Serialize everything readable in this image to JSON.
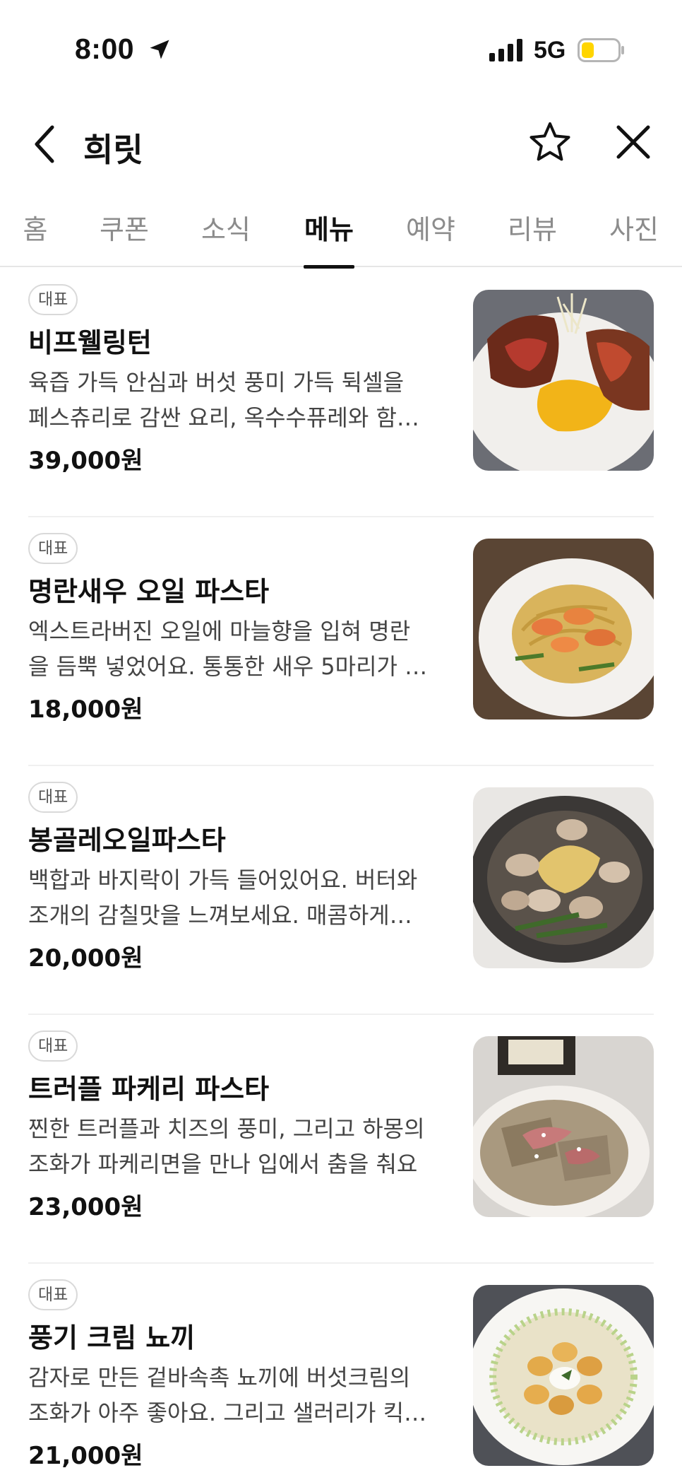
{
  "status_bar": {
    "time": "8:00",
    "network": "5G",
    "icons": [
      "location-arrow-icon",
      "signal-icon",
      "battery-icon"
    ],
    "battery_color": "#ffd500"
  },
  "header": {
    "title": "희릿",
    "icons": [
      "back-icon",
      "star-icon",
      "close-icon"
    ]
  },
  "tabs": [
    {
      "label": "홈",
      "active": false
    },
    {
      "label": "쿠폰",
      "active": false
    },
    {
      "label": "소식",
      "active": false
    },
    {
      "label": "메뉴",
      "active": true
    },
    {
      "label": "예약",
      "active": false
    },
    {
      "label": "리뷰",
      "active": false
    },
    {
      "label": "사진",
      "active": false
    }
  ],
  "menu_items": [
    {
      "badge": "대표",
      "name": "비프웰링턴",
      "desc_line1": "육즙 가득 안심과 버섯 풍미 가득 뒥셀을",
      "desc_line2": "페스츄리로 감싼 요리, 옥수수퓨레와 함…",
      "price": "39,000원",
      "image": "beef-wellington-photo"
    },
    {
      "badge": "대표",
      "name": "명란새우 오일 파스타",
      "desc_line1": "엑스트라버진 오일에 마늘향을 입혀 명란",
      "desc_line2": "을 듬뿍 넣었어요. 통통한 새우 5마리가 …",
      "price": "18,000원",
      "image": "shrimp-pasta-photo"
    },
    {
      "badge": "대표",
      "name": "봉골레오일파스타",
      "desc_line1": "백합과 바지락이 가득 들어있어요. 버터와",
      "desc_line2": "조개의 감칠맛을 느껴보세요. 매콤하게…",
      "price": "20,000원",
      "image": "vongole-pasta-photo"
    },
    {
      "badge": "대표",
      "name": "트러플 파케리 파스타",
      "desc_line1": "찐한 트러플과 치즈의 풍미, 그리고 하몽의",
      "desc_line2": "조화가 파케리면을 만나 입에서 춤을 춰요",
      "price": "23,000원",
      "image": "truffle-paccheri-photo"
    },
    {
      "badge": "대표",
      "name": "풍기 크림 뇨끼",
      "desc_line1": "감자로 만든 겉바속촉 뇨끼에 버섯크림의",
      "desc_line2": "조화가 아주 좋아요. 그리고 샐러리가 킥…",
      "price": "21,000원",
      "image": "cream-gnocchi-photo"
    }
  ]
}
